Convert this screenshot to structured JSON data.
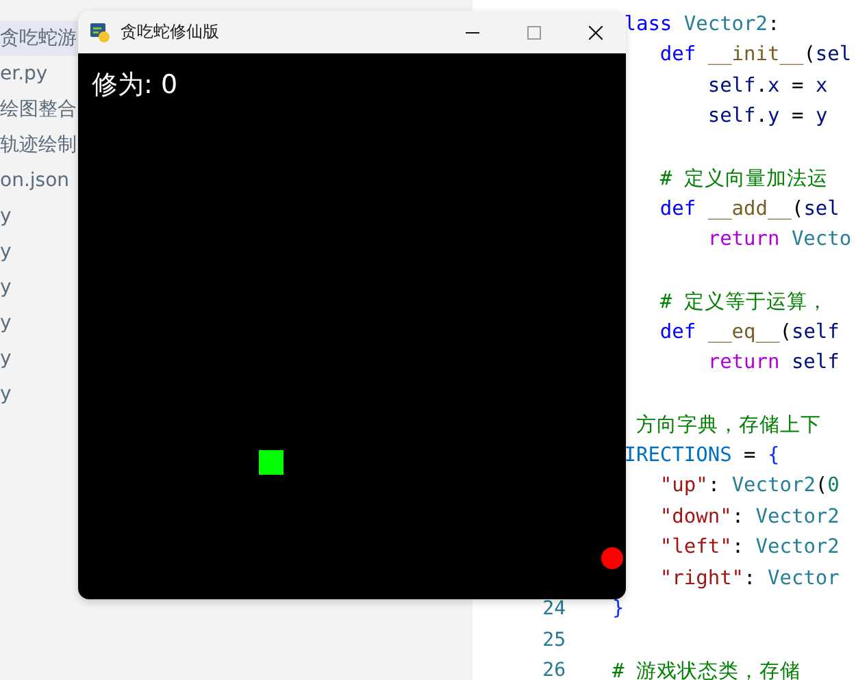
{
  "sidebar": {
    "items": [
      {
        "label": "贪吃蛇游",
        "selected": true,
        "color": "#5b6b7c"
      },
      {
        "label": "er.py",
        "selected": false,
        "color": "#5b6b7c"
      },
      {
        "label": "绘图整合",
        "selected": false,
        "color": "#5b6b7c"
      },
      {
        "label": "轨迹绘制",
        "selected": false,
        "color": "#5b6b7c"
      },
      {
        "label": "on.json",
        "selected": false,
        "color": "#5b6b7c"
      },
      {
        "label": "y",
        "selected": false,
        "color": "#5b6b7c"
      },
      {
        "label": "y",
        "selected": false,
        "color": "#5b6b7c"
      },
      {
        "label": "y",
        "selected": false,
        "color": "#5b6b7c"
      },
      {
        "label": "y",
        "selected": false,
        "color": "#5b6b7c"
      },
      {
        "label": "y",
        "selected": false,
        "color": "#5b6b7c"
      },
      {
        "label": "y",
        "selected": false,
        "color": "#5b6b7c"
      }
    ]
  },
  "editor": {
    "lines": [
      {
        "tokens": [
          {
            "text": " lass ",
            "kind": "keyword"
          },
          {
            "text": "Vector2",
            "kind": "class"
          },
          {
            "text": ":"
          }
        ]
      },
      {
        "tokens": [
          {
            "text": "    def ",
            "kind": "keyword"
          },
          {
            "text": "__init__",
            "kind": "function"
          },
          {
            "text": "("
          },
          {
            "text": "sel",
            "kind": "variable"
          }
        ]
      },
      {
        "tokens": [
          {
            "text": "        self",
            "kind": "variable"
          },
          {
            "text": "."
          },
          {
            "text": "x",
            "kind": "variable"
          },
          {
            "text": " = "
          },
          {
            "text": "x",
            "kind": "variable"
          }
        ]
      },
      {
        "tokens": [
          {
            "text": "        self",
            "kind": "variable"
          },
          {
            "text": "."
          },
          {
            "text": "y",
            "kind": "variable"
          },
          {
            "text": " = "
          },
          {
            "text": "y",
            "kind": "variable"
          }
        ]
      },
      {
        "kind": "blank"
      },
      {
        "tokens": [
          {
            "text": "    # 定义向量加法运",
            "kind": "comment"
          }
        ]
      },
      {
        "tokens": [
          {
            "text": "    def ",
            "kind": "keyword"
          },
          {
            "text": "__add__",
            "kind": "function"
          },
          {
            "text": "("
          },
          {
            "text": "sel",
            "kind": "variable"
          }
        ]
      },
      {
        "tokens": [
          {
            "text": "        return ",
            "kind": "control"
          },
          {
            "text": "Vecto",
            "kind": "class"
          }
        ]
      },
      {
        "kind": "blank"
      },
      {
        "tokens": [
          {
            "text": "    # 定义等于运算，",
            "kind": "comment"
          }
        ]
      },
      {
        "tokens": [
          {
            "text": "    def ",
            "kind": "keyword"
          },
          {
            "text": "__eq__",
            "kind": "function"
          },
          {
            "text": "("
          },
          {
            "text": "self",
            "kind": "variable"
          }
        ]
      },
      {
        "tokens": [
          {
            "text": "        return ",
            "kind": "control"
          },
          {
            "text": "self",
            "kind": "variable"
          }
        ]
      },
      {
        "kind": "blank"
      },
      {
        "tokens": [
          {
            "text": "  方向字典，存储上下",
            "kind": "comment"
          }
        ]
      },
      {
        "tokens": [
          {
            "text": " IRECTIONS",
            "kind": "constant"
          },
          {
            "text": " = "
          },
          {
            "text": "{",
            "kind": "bracket"
          }
        ]
      },
      {
        "tokens": [
          {
            "text": "    \"up\"",
            "kind": "string"
          },
          {
            "text": ": "
          },
          {
            "text": "Vector2",
            "kind": "class"
          },
          {
            "text": "("
          },
          {
            "text": "0",
            "kind": "number"
          }
        ]
      },
      {
        "tokens": [
          {
            "text": "    \"down\"",
            "kind": "string"
          },
          {
            "text": ": "
          },
          {
            "text": "Vector2",
            "kind": "class"
          }
        ]
      },
      {
        "tokens": [
          {
            "text": "    \"left\"",
            "kind": "string"
          },
          {
            "text": ": "
          },
          {
            "text": "Vector2",
            "kind": "class"
          }
        ]
      },
      {
        "tokens": [
          {
            "text": "    \"right\"",
            "kind": "string"
          },
          {
            "text": ": "
          },
          {
            "text": "Vector",
            "kind": "class"
          }
        ]
      },
      {
        "number": "24",
        "tokens": [
          {
            "text": "}",
            "kind": "bracket"
          }
        ]
      },
      {
        "number": "25",
        "kind": "blank"
      },
      {
        "number": "26",
        "tokens": [
          {
            "text": "# 游戏状态类，存储",
            "kind": "comment"
          }
        ]
      }
    ]
  },
  "game_window": {
    "title": "贪吃蛇修仙版",
    "score": "修为: 0"
  }
}
